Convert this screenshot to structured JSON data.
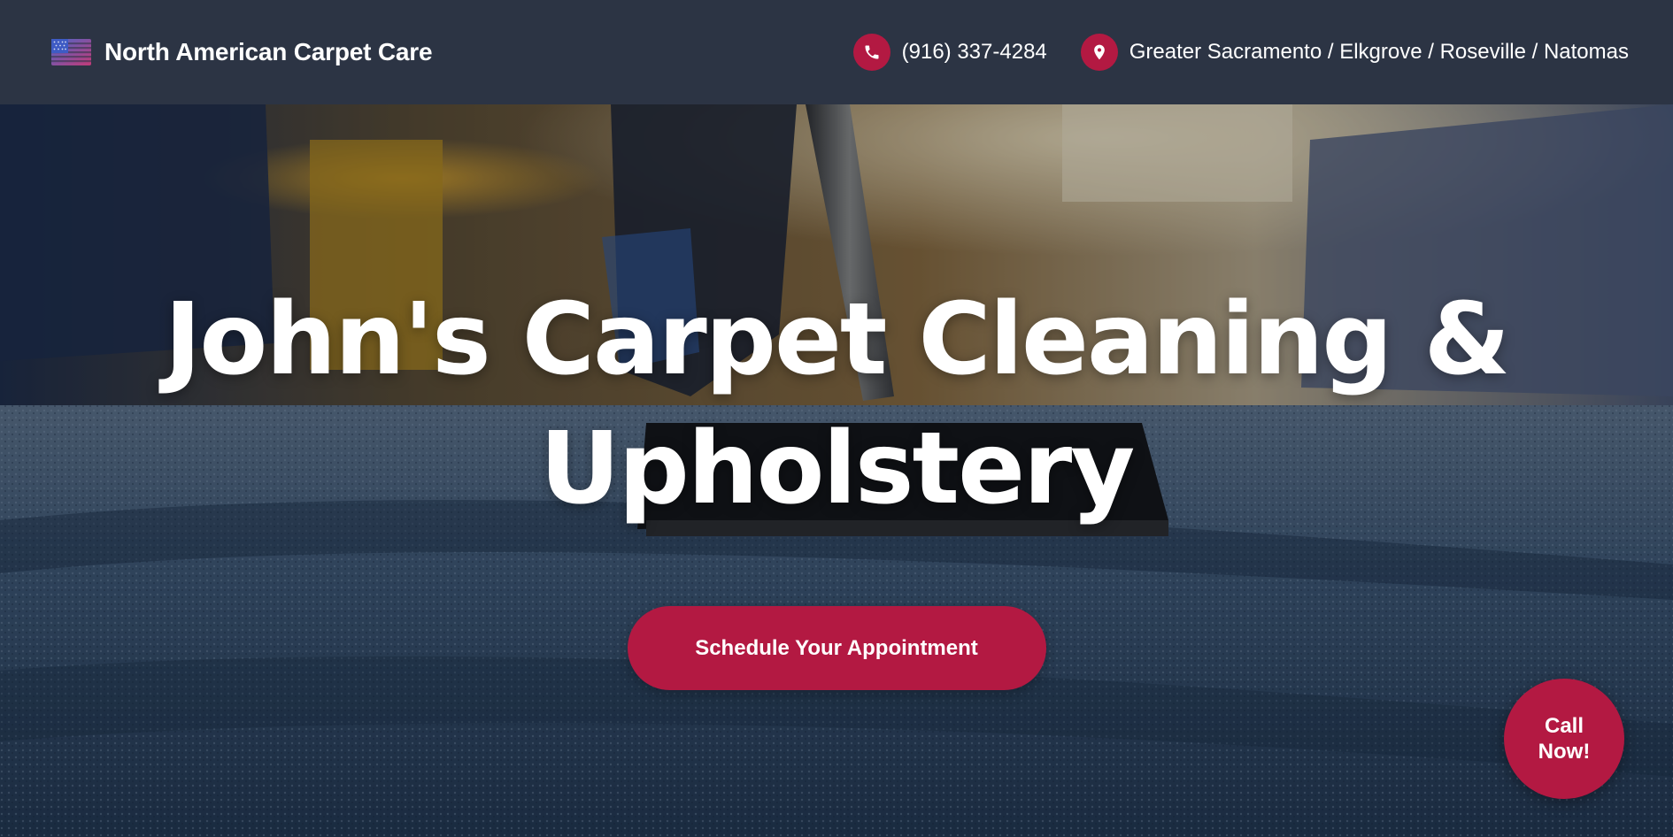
{
  "header": {
    "brand_name": "North American Carpet Care",
    "logo_icon": "us-flag-icon",
    "phone": {
      "icon": "phone-icon",
      "text": "(916) 337-4284"
    },
    "location": {
      "icon": "map-pin-icon",
      "text": "Greater Sacramento / Elkgrove / Roseville / Natomas"
    }
  },
  "hero": {
    "title": "John's Carpet Cleaning & Upholstery",
    "cta_label": "Schedule Your Appointment"
  },
  "call_button": {
    "label": "Call Now!"
  },
  "colors": {
    "header_bg": "#2c3444",
    "accent": "#b31942",
    "text": "#ffffff"
  }
}
